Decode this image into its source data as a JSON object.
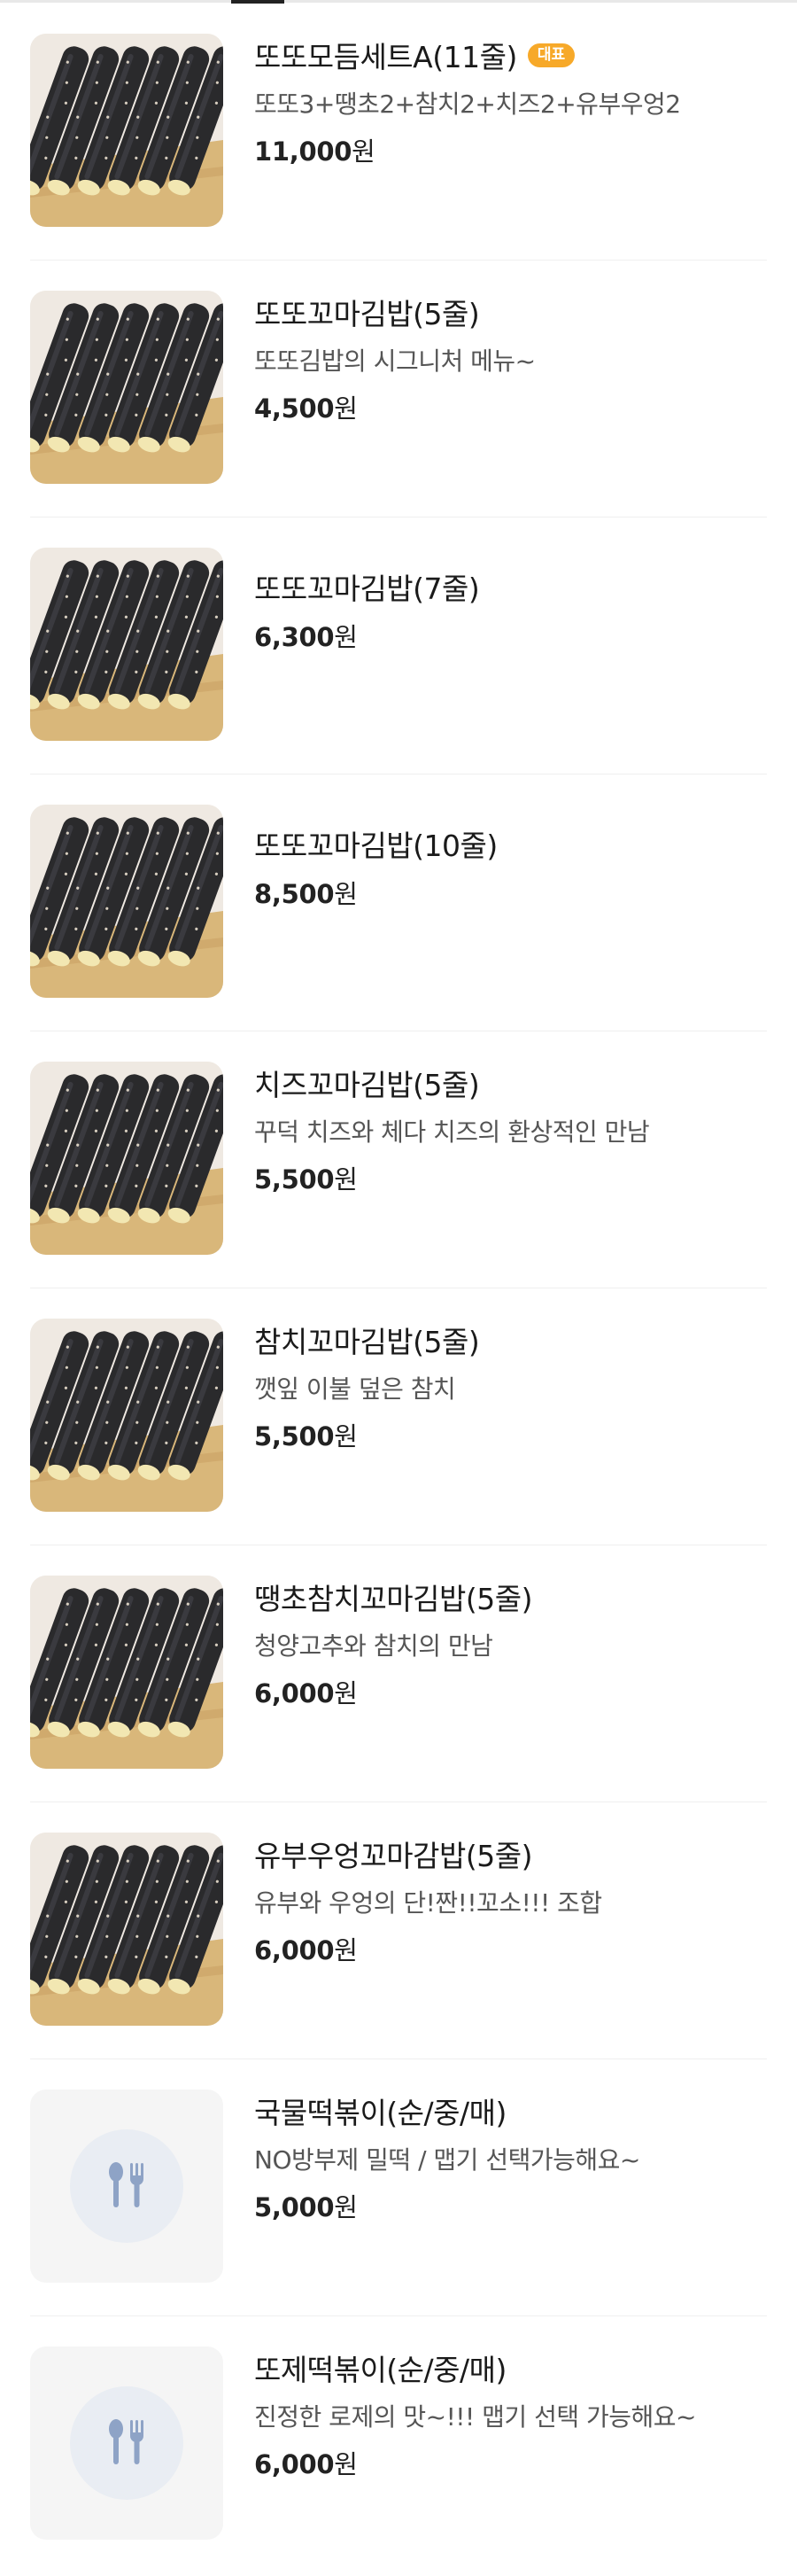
{
  "colors": {
    "badge_bg": "#f7a929",
    "placeholder_bg": "#f5f5f5",
    "placeholder_circle": "#e9edf3",
    "placeholder_icon": "#8ea3c6"
  },
  "items": [
    {
      "name": "또또모듬세트A(11줄)",
      "badge": "대표",
      "desc": "또또3+땡초2+참치2+치즈2+유부우엉2",
      "price": "11,000",
      "unit": "원",
      "image": "kimbap-photo"
    },
    {
      "name": "또또꼬마김밥(5줄)",
      "desc": "또또김밥의 시그니처 메뉴~",
      "price": "4,500",
      "unit": "원",
      "image": "kimbap-photo"
    },
    {
      "name": "또또꼬마김밥(7줄)",
      "desc": "",
      "price": "6,300",
      "unit": "원",
      "image": "kimbap-photo"
    },
    {
      "name": "또또꼬마김밥(10줄)",
      "desc": "",
      "price": "8,500",
      "unit": "원",
      "image": "kimbap-photo"
    },
    {
      "name": "치즈꼬마김밥(5줄)",
      "desc": "꾸덕 치즈와 체다 치즈의 환상적인 만남",
      "price": "5,500",
      "unit": "원",
      "image": "kimbap-photo"
    },
    {
      "name": "참치꼬마김밥(5줄)",
      "desc": "깻잎 이불 덮은 참치",
      "price": "5,500",
      "unit": "원",
      "image": "kimbap-photo"
    },
    {
      "name": "땡초참치꼬마김밥(5줄)",
      "desc": "청양고추와 참치의 만남",
      "price": "6,000",
      "unit": "원",
      "image": "kimbap-photo"
    },
    {
      "name": "유부우엉꼬마감밥(5줄)",
      "desc": "유부와 우엉의 단!짠!!꼬소!!! 조합",
      "price": "6,000",
      "unit": "원",
      "image": "kimbap-photo"
    },
    {
      "name": "국물떡볶이(순/중/매)",
      "desc": "NO방부제 밀떡 / 맵기 선택가능해요~",
      "price": "5,000",
      "unit": "원",
      "image": "spoon-fork-icon"
    },
    {
      "name": "또제떡볶이(순/중/매)",
      "desc": "진정한 로제의 맛~!!! 맵기 선택 가능해요~",
      "price": "6,000",
      "unit": "원",
      "image": "spoon-fork-icon"
    }
  ]
}
